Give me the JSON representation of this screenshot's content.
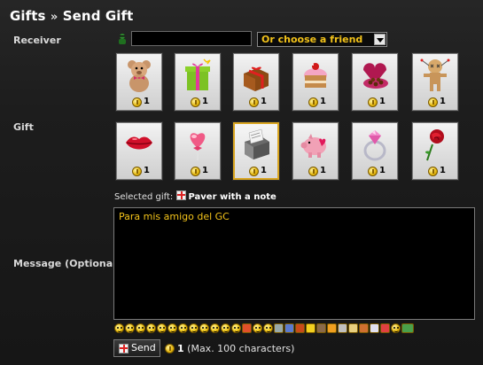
{
  "header": {
    "section": "Gifts",
    "separator": "»",
    "page": "Send Gift"
  },
  "receiver": {
    "label": "Receiver",
    "input_value": "",
    "choose_friend": "Or choose a friend"
  },
  "gift_label": "Gift",
  "gifts": [
    {
      "name": "teddy-bear",
      "cost": "1"
    },
    {
      "name": "gift-box",
      "cost": "1"
    },
    {
      "name": "wrapped-present",
      "cost": "1"
    },
    {
      "name": "cupcake",
      "cost": "1"
    },
    {
      "name": "chocolate-box",
      "cost": "1"
    },
    {
      "name": "voodoo-doll",
      "cost": "1"
    },
    {
      "name": "lips",
      "cost": "1"
    },
    {
      "name": "heart-lollipop",
      "cost": "1"
    },
    {
      "name": "paver-with-note",
      "cost": "1",
      "selected": true
    },
    {
      "name": "piggy-bank",
      "cost": "1"
    },
    {
      "name": "diamond-ring",
      "cost": "1"
    },
    {
      "name": "rose",
      "cost": "1"
    }
  ],
  "selected_gift": {
    "prefix": "Selected gift:",
    "name": "Paver with a note"
  },
  "message": {
    "label": "Message (Optional)",
    "value": "Para mis amigo del GC"
  },
  "send": {
    "button_label": "Send",
    "cost": "1",
    "max_note": "(Max. 100 characters)"
  },
  "colors": {
    "accent": "#f2c21a",
    "selected_border": "#d9a520",
    "background": "#1b1b1b"
  }
}
